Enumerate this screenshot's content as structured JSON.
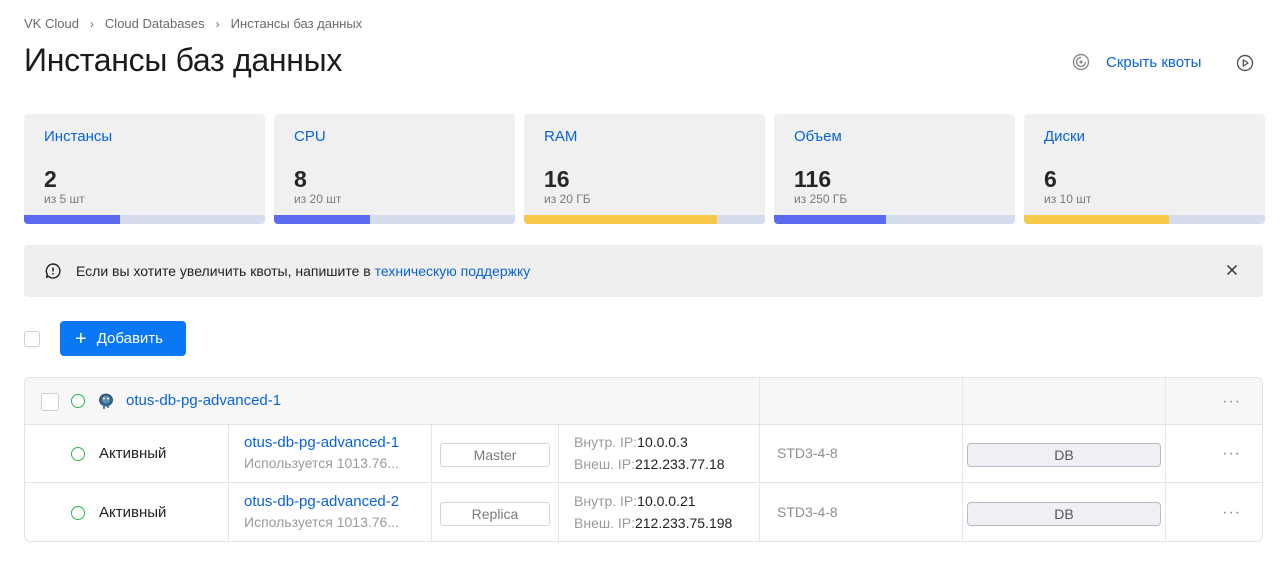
{
  "breadcrumb": [
    "VK Cloud",
    "Cloud Databases",
    "Инстансы баз данных"
  ],
  "page_title": "Инстансы баз данных",
  "header_actions": {
    "hide_quotas_label": "Скрыть квоты"
  },
  "quotas": [
    {
      "title": "Инстансы",
      "value": "2",
      "sub": "из 5 шт",
      "fraction": 0.4,
      "color": "#5b6bf0"
    },
    {
      "title": "CPU",
      "value": "8",
      "sub": "из 20 шт",
      "fraction": 0.4,
      "color": "#5b6bf0"
    },
    {
      "title": "RAM",
      "value": "16",
      "sub": "из 20 ГБ",
      "fraction": 0.8,
      "color": "#f7c948"
    },
    {
      "title": "Объем",
      "value": "116",
      "sub": "из 250 ГБ",
      "fraction": 0.464,
      "color": "#5b6bf0"
    },
    {
      "title": "Диски",
      "value": "6",
      "sub": "из 10 шт",
      "fraction": 0.6,
      "color": "#f7c948"
    }
  ],
  "banner": {
    "text": "Если вы хотите увеличить квоты, напишите в ",
    "link": "техническую поддержку"
  },
  "add_button_label": "Добавить",
  "group": {
    "name": "otus-db-pg-advanced-1",
    "more": "···"
  },
  "instances": [
    {
      "status": "Активный",
      "name": "otus-db-pg-advanced-1",
      "usage": "Используется 1013.76...",
      "role": "Master",
      "int_ip_label": "Внутр. IP:",
      "int_ip": "10.0.0.3",
      "ext_ip_label": "Внеш. IP:",
      "ext_ip": "212.233.77.18",
      "flavor": "STD3-4-8",
      "type": "DB",
      "more": "···"
    },
    {
      "status": "Активный",
      "name": "otus-db-pg-advanced-2",
      "usage": "Используется 1013.76...",
      "role": "Replica",
      "int_ip_label": "Внутр. IP:",
      "int_ip": "10.0.0.21",
      "ext_ip_label": "Внеш. IP:",
      "ext_ip": "212.233.75.198",
      "flavor": "STD3-4-8",
      "type": "DB",
      "more": "···"
    }
  ]
}
